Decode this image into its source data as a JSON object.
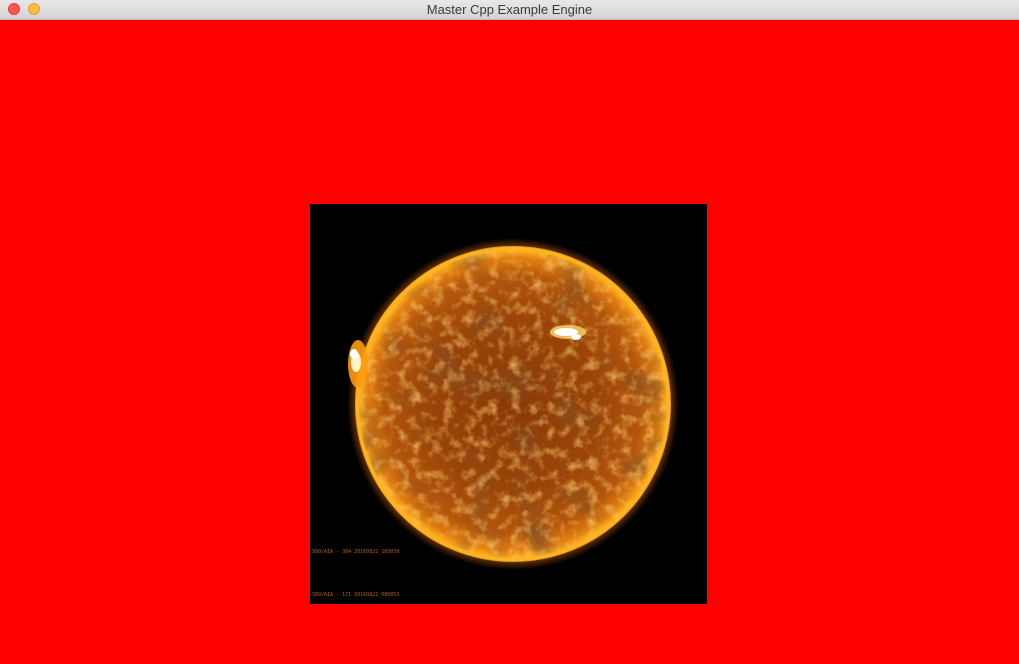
{
  "window": {
    "title": "Master Cpp Example Engine",
    "background_color": "#ff0000"
  },
  "titlebar": {
    "close_icon": "close-circle-icon",
    "minimize_icon": "minimize-circle-icon",
    "close_color": "#fc5753",
    "minimize_color": "#fdbc40"
  },
  "scene": {
    "sprite": {
      "subject": "sun",
      "caption_top": "SDO/AIA - 304 20160822_103039",
      "caption_bottom": "SDO/AIA - 171 20160822_080853"
    }
  }
}
